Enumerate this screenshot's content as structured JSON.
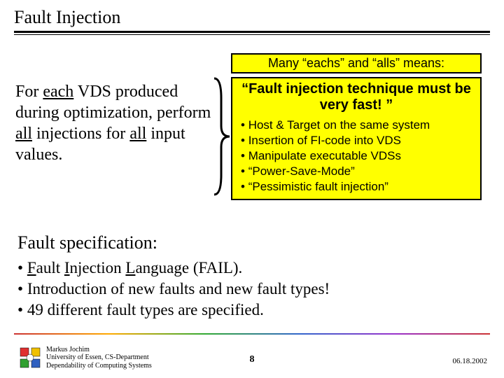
{
  "title": "Fault Injection",
  "left_paragraph": {
    "pre1": "For ",
    "u1": "each",
    "post1": " VDS produced during optimization, perform ",
    "u2": "all",
    "post2": " injections for ",
    "u3": "all",
    "post3": " input values."
  },
  "box1": "Many “eachs” and “alls” means:",
  "box2": {
    "headline": "“Fault injection technique must be very fast! ”",
    "items": [
      "Host & Target on the same system",
      "Insertion of FI-code into VDS",
      "Manipulate executable VDSs",
      "“Power-Save-Mode”",
      "“Pessimistic fault injection”"
    ]
  },
  "subhead": "Fault specification:",
  "spec_items": {
    "i0": {
      "pre": "",
      "u1": "F",
      "mid1": "ault ",
      "u2": "I",
      "mid2": "njection ",
      "u3": "L",
      "post": "anguage (FAIL)."
    },
    "i1": {
      "text": "Introduction of new faults and new fault types!"
    },
    "i2": {
      "text": "49 different fault types are specified."
    }
  },
  "footer": {
    "author": "Markus Jochim",
    "affil": "University of Essen, CS-Department",
    "group": "Dependability of Computing Systems",
    "page": "8",
    "date": "06.18.2002"
  }
}
